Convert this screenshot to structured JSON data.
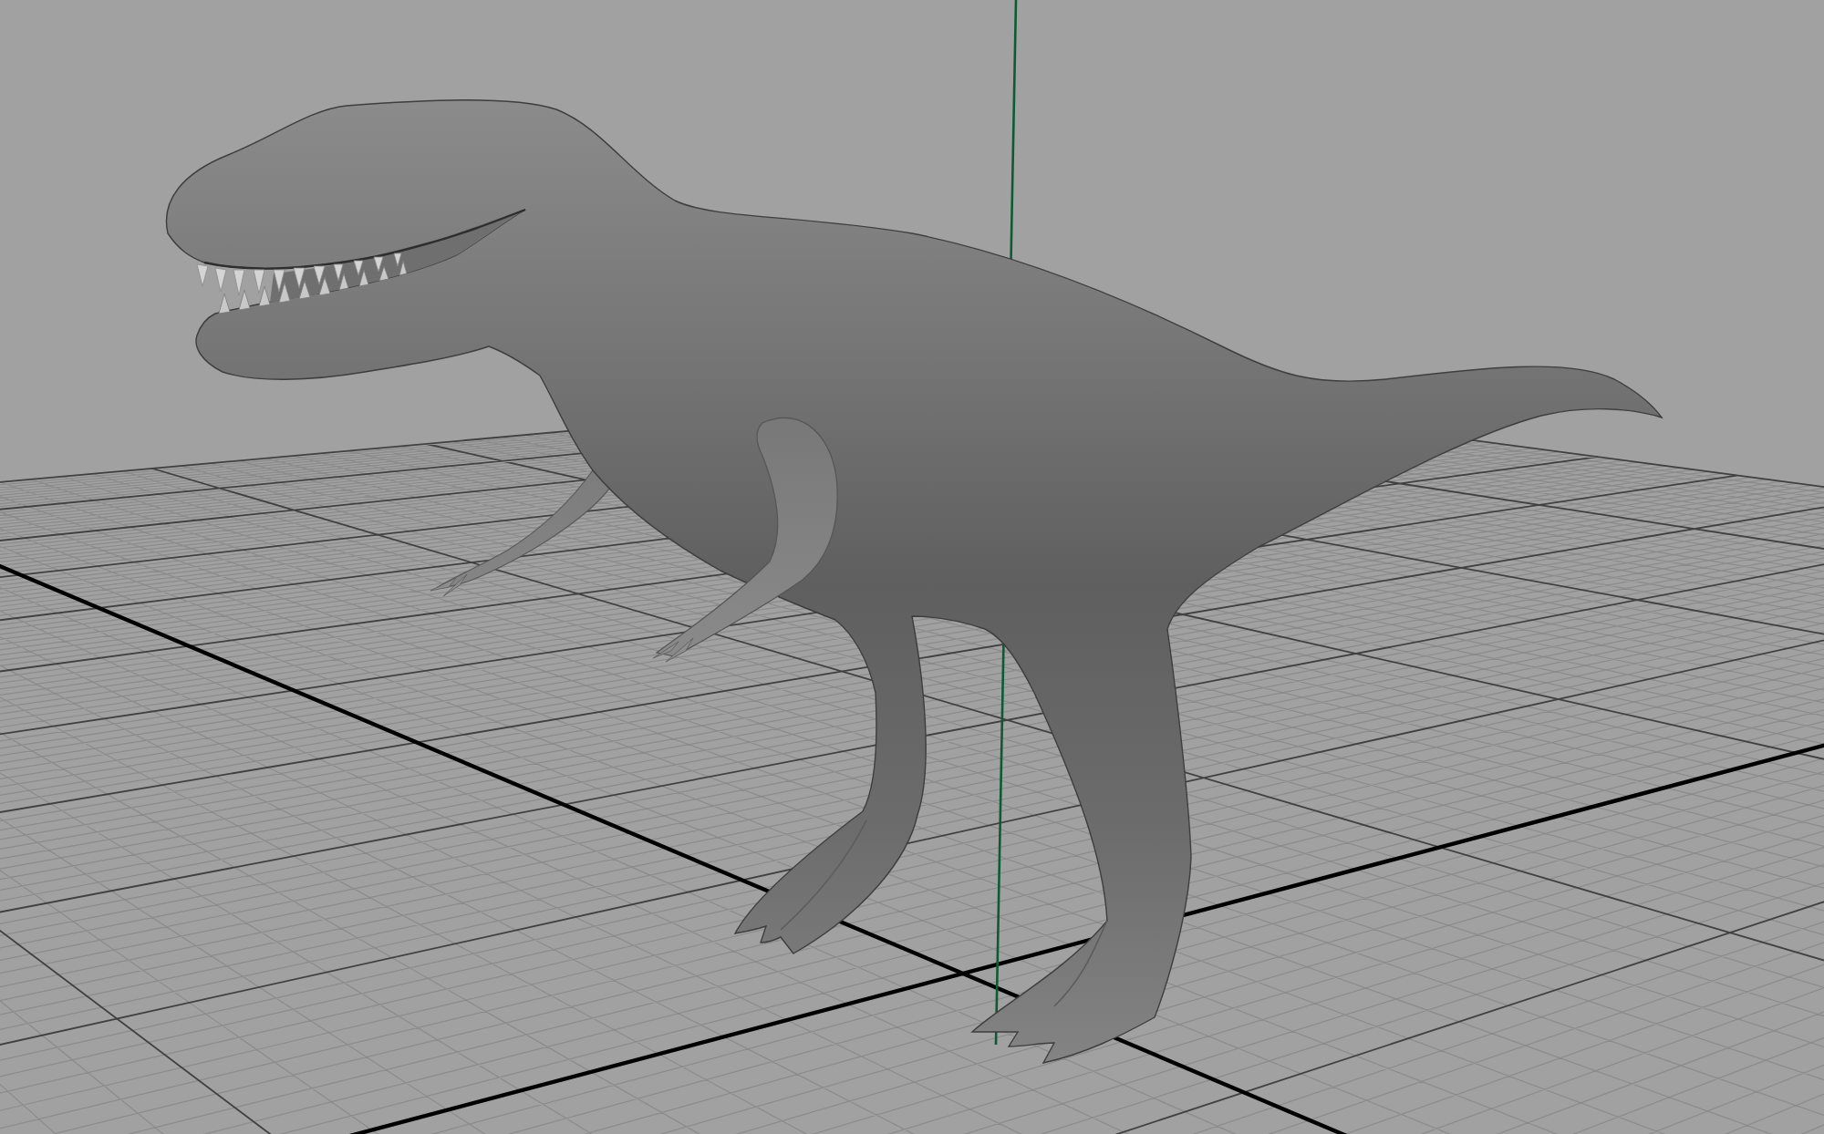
{
  "viewport": {
    "grid": true,
    "y_axis": true
  }
}
